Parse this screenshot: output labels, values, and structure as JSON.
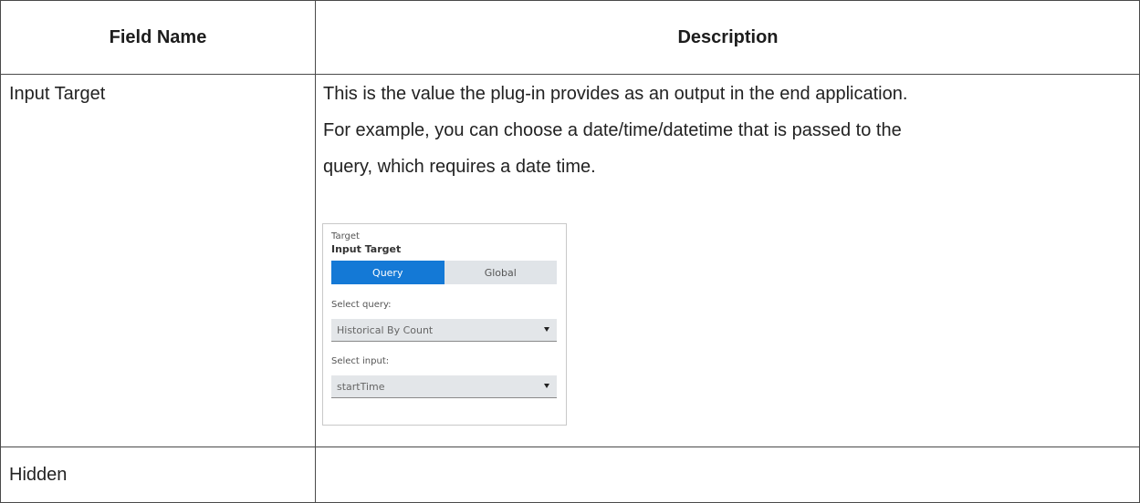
{
  "table": {
    "headers": [
      "Field Name",
      "Description"
    ],
    "rows": [
      {
        "field": "Input Target",
        "description_lines": [
          "This is the value the plug-in provides as an output in the end application.",
          "For example, you can choose a date/time/datetime that is passed to the",
          "query, which requires a date time."
        ]
      },
      {
        "field": "Hidden",
        "description_lines": []
      }
    ]
  },
  "panel": {
    "section_label": "Target",
    "title": "Input Target",
    "tabs": [
      {
        "label": "Query",
        "active": true
      },
      {
        "label": "Global",
        "active": false
      }
    ],
    "select_query_label": "Select query:",
    "select_query_value": "Historical By Count",
    "select_input_label": "Select input:",
    "select_input_value": "startTime",
    "colors": {
      "active_tab": "#1479d6",
      "inactive_tab": "#e0e4e8",
      "dropdown_bg": "#e3e6e9"
    }
  }
}
